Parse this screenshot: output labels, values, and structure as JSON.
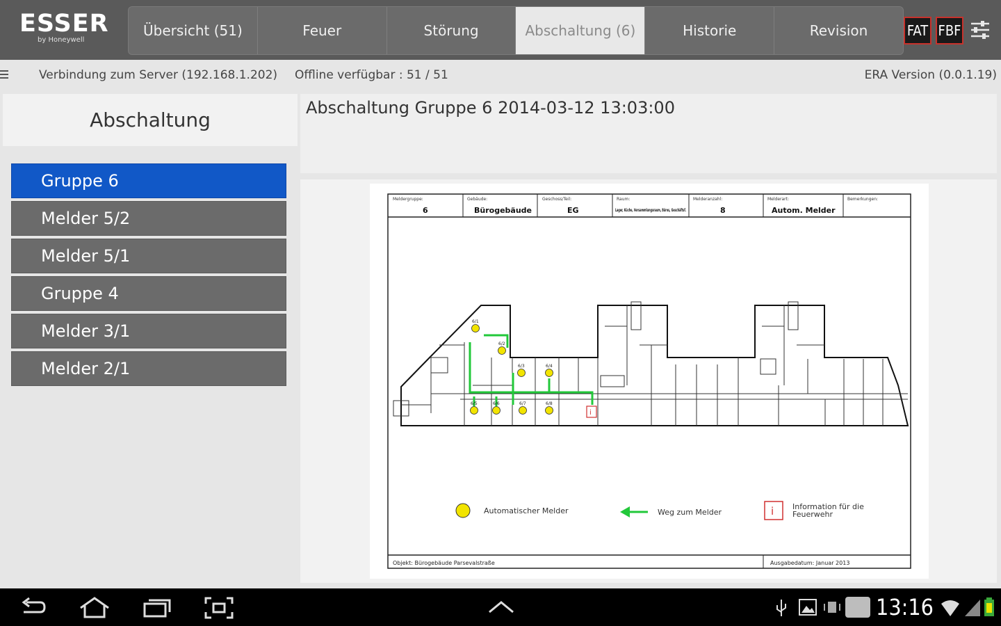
{
  "logo": {
    "brand": "ESSER",
    "sub": "by Honeywell"
  },
  "tabs": [
    {
      "label": "Übersicht (51)"
    },
    {
      "label": "Feuer"
    },
    {
      "label": "Störung"
    },
    {
      "label": "Abschaltung (6)",
      "active": true
    },
    {
      "label": "Historie"
    },
    {
      "label": "Revision"
    }
  ],
  "badges": {
    "fat": "FAT",
    "fbf": "FBF"
  },
  "status": {
    "server": "Verbindung zum Server (192.168.1.202)",
    "offline": "Offline verfügbar : 51 / 51",
    "version": "ERA Version (0.0.1.19)"
  },
  "left": {
    "title": "Abschaltung",
    "items": [
      {
        "label": "Gruppe 6",
        "active": true
      },
      {
        "label": "Melder 5/2"
      },
      {
        "label": "Melder 5/1"
      },
      {
        "label": "Gruppe 4"
      },
      {
        "label": "Melder 3/1"
      },
      {
        "label": "Melder 2/1"
      }
    ]
  },
  "event": {
    "title": "Abschaltung Gruppe 6 2014-03-12 13:03:00"
  },
  "plan": {
    "header": [
      {
        "caption": "Meldergruppe:",
        "value": "6"
      },
      {
        "caption": "Gebäude:",
        "value": "Bürogebäude"
      },
      {
        "caption": "Geschoss/Teil:",
        "value": "EG"
      },
      {
        "caption": "Raum:",
        "value": "Lager, Küche, Versammlungsraum, Büros, Geschäftsf."
      },
      {
        "caption": "Melderanzahl:",
        "value": "8"
      },
      {
        "caption": "Melderart:",
        "value": "Autom. Melder"
      },
      {
        "caption": "Bemerkungen:",
        "value": ""
      }
    ],
    "legend": {
      "detector": "Automatischer Melder",
      "path": "Weg zum Melder",
      "info": "Information für die Feuerwehr",
      "info_glyph": "i"
    },
    "footer_left": "Objekt: Bürogebäude Parsevalstraße",
    "footer_right": "Ausgabedatum: Januar 2013",
    "detector_labels": [
      "6/1",
      "6/2",
      "6/3",
      "6/4",
      "6/5",
      "6/6",
      "6/7",
      "6/8"
    ]
  },
  "navbar": {
    "clock": "13:16"
  },
  "colors": {
    "accent": "#1158c7",
    "badge_border": "#c8322c",
    "detector": "#f2e400",
    "path": "#22c83a",
    "info": "#d03030"
  }
}
